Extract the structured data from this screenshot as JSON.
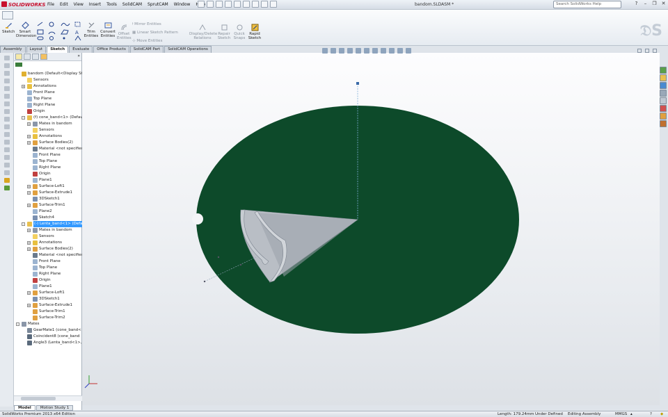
{
  "app": {
    "logo_text": "SOLIDWORKS",
    "document_title": "bandom.SLDASM *",
    "menus": [
      "File",
      "Edit",
      "View",
      "Insert",
      "Tools",
      "SolidCAM",
      "SprutCAM",
      "Window",
      "Help"
    ],
    "help_search_placeholder": "Search SolidWorks Help"
  },
  "ribbon": {
    "sketch": "Sketch",
    "smart_dimension": "Smart Dimension",
    "trim_entities": "Trim Entities",
    "convert_entities": "Convert Entities",
    "offset_entities": "Offset Entities",
    "mirror_entities": "Mirror Entities",
    "linear_sketch_pattern": "Linear Sketch Pattern",
    "move_entities": "Move Entities",
    "display_delete_relations": "Display/Delete Relations",
    "repair_sketch": "Repair Sketch",
    "quick_snaps": "Quick Snaps",
    "rapid_sketch": "Rapid Sketch"
  },
  "tabs": [
    "Assembly",
    "Layout",
    "Sketch",
    "Evaluate",
    "Office Products",
    "SolidCAM Part",
    "SolidCAM Operations"
  ],
  "active_tab": "Sketch",
  "tree": [
    {
      "label": "bandom  (Default<Display State",
      "indent": 0,
      "icon": "assembly",
      "expander": ""
    },
    {
      "label": "Sensors",
      "indent": 1,
      "icon": "folder",
      "expander": ""
    },
    {
      "label": "Annotations",
      "indent": 1,
      "icon": "annotation",
      "expander": "+"
    },
    {
      "label": "Front Plane",
      "indent": 1,
      "icon": "plane",
      "expander": ""
    },
    {
      "label": "Top Plane",
      "indent": 1,
      "icon": "plane",
      "expander": ""
    },
    {
      "label": "Right Plane",
      "indent": 1,
      "icon": "plane",
      "expander": ""
    },
    {
      "label": "Origin",
      "indent": 1,
      "icon": "origin",
      "expander": ""
    },
    {
      "label": "(f) cone_band<1> (Default<",
      "indent": 1,
      "icon": "part",
      "expander": "-"
    },
    {
      "label": "Mates in bandom",
      "indent": 2,
      "icon": "mate",
      "expander": "+"
    },
    {
      "label": "Sensors",
      "indent": 2,
      "icon": "folder",
      "expander": ""
    },
    {
      "label": "Annotations",
      "indent": 2,
      "icon": "annotation",
      "expander": "+"
    },
    {
      "label": "Surface Bodies(2)",
      "indent": 2,
      "icon": "surface",
      "expander": "+"
    },
    {
      "label": "Material <not specified>",
      "indent": 2,
      "icon": "material",
      "expander": ""
    },
    {
      "label": "Front Plane",
      "indent": 2,
      "icon": "plane",
      "expander": ""
    },
    {
      "label": "Top Plane",
      "indent": 2,
      "icon": "plane",
      "expander": ""
    },
    {
      "label": "Right Plane",
      "indent": 2,
      "icon": "plane",
      "expander": ""
    },
    {
      "label": "Origin",
      "indent": 2,
      "icon": "origin",
      "expander": ""
    },
    {
      "label": "Plane1",
      "indent": 2,
      "icon": "plane",
      "expander": ""
    },
    {
      "label": "Surface-Loft1",
      "indent": 2,
      "icon": "feature",
      "expander": "+"
    },
    {
      "label": "Surface-Extrude1",
      "indent": 2,
      "icon": "feature",
      "expander": "+"
    },
    {
      "label": "3DSketch1",
      "indent": 2,
      "icon": "sketch",
      "expander": ""
    },
    {
      "label": "Surface-Trim1",
      "indent": 2,
      "icon": "feature",
      "expander": "+"
    },
    {
      "label": "Plane2",
      "indent": 2,
      "icon": "plane",
      "expander": ""
    },
    {
      "label": "Sketch4",
      "indent": 2,
      "icon": "sketch",
      "expander": ""
    },
    {
      "label": "(-) Lenta_band<1> (Default",
      "indent": 1,
      "icon": "part",
      "expander": "-",
      "selected": true
    },
    {
      "label": "Mates in bandom",
      "indent": 2,
      "icon": "mate",
      "expander": "+"
    },
    {
      "label": "Sensors",
      "indent": 2,
      "icon": "folder",
      "expander": ""
    },
    {
      "label": "Annotations",
      "indent": 2,
      "icon": "annotation",
      "expander": "+"
    },
    {
      "label": "Surface Bodies(2)",
      "indent": 2,
      "icon": "surface",
      "expander": "+"
    },
    {
      "label": "Material <not specified>",
      "indent": 2,
      "icon": "material",
      "expander": ""
    },
    {
      "label": "Front Plane",
      "indent": 2,
      "icon": "plane",
      "expander": ""
    },
    {
      "label": "Top Plane",
      "indent": 2,
      "icon": "plane",
      "expander": ""
    },
    {
      "label": "Right Plane",
      "indent": 2,
      "icon": "plane",
      "expander": ""
    },
    {
      "label": "Origin",
      "indent": 2,
      "icon": "origin",
      "expander": ""
    },
    {
      "label": "Plane1",
      "indent": 2,
      "icon": "plane",
      "expander": ""
    },
    {
      "label": "Surface-Loft1",
      "indent": 2,
      "icon": "feature",
      "expander": "+"
    },
    {
      "label": "3DSketch1",
      "indent": 2,
      "icon": "sketch",
      "expander": ""
    },
    {
      "label": "Surface-Extrude1",
      "indent": 2,
      "icon": "feature",
      "expander": "+"
    },
    {
      "label": "Surface-Trim1",
      "indent": 2,
      "icon": "feature",
      "expander": ""
    },
    {
      "label": "Surface-Trim2",
      "indent": 2,
      "icon": "feature",
      "expander": ""
    },
    {
      "label": "Mates",
      "indent": 0,
      "icon": "mate",
      "expander": "-"
    },
    {
      "label": "GearMate1 (cone_band<",
      "indent": 1,
      "icon": "gear",
      "expander": ""
    },
    {
      "label": "Coincident8 (cone_band",
      "indent": 1,
      "icon": "coincident",
      "expander": ""
    },
    {
      "label": "Angle3 (Lenta_band<1>,",
      "indent": 1,
      "icon": "angle",
      "expander": ""
    }
  ],
  "bottom_tabs": [
    "Model",
    "Motion Study 1"
  ],
  "active_bottom_tab": "Model",
  "status": {
    "edition": "SolidWorks Premium 2013 x64 Edition",
    "length": "Length: 179.24mm",
    "state": "Under Defined",
    "mode": "Editing Assembly",
    "units": "MMGS"
  },
  "colors": {
    "disk": "#0d4a2a",
    "selection": "#3399ff"
  }
}
